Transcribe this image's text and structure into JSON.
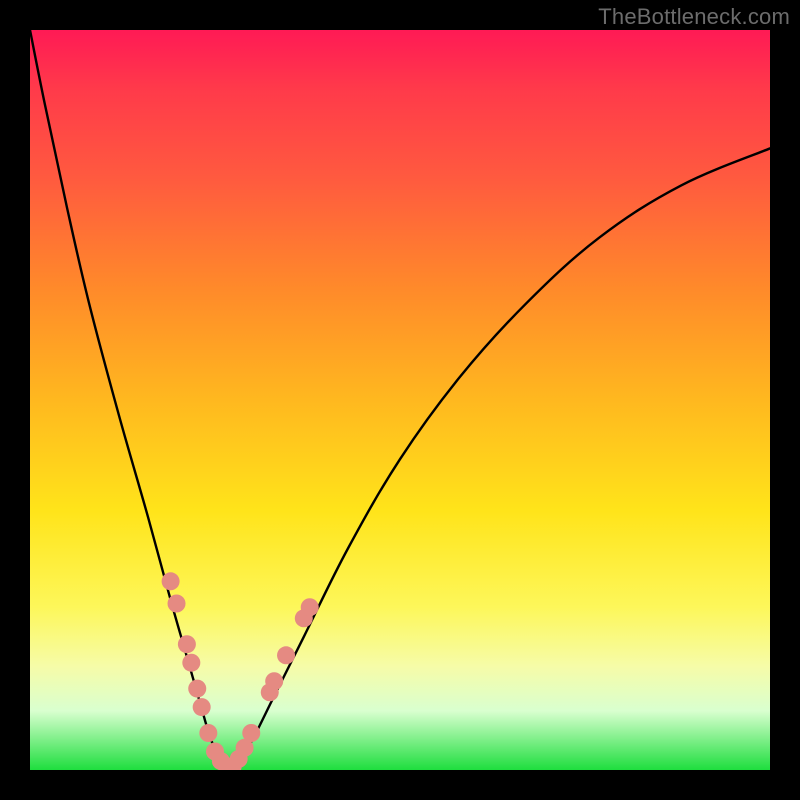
{
  "watermark": {
    "text": "TheBottleneck.com"
  },
  "chart_data": {
    "type": "line",
    "title": "",
    "xlabel": "",
    "ylabel": "",
    "xlim": [
      0,
      100
    ],
    "ylim": [
      0,
      100
    ],
    "series": [
      {
        "name": "bottleneck-curve",
        "x": [
          0,
          2,
          5,
          8,
          12,
          16,
          19,
          21,
          23,
          24.5,
          26,
          27,
          28,
          30,
          33,
          37,
          43,
          50,
          58,
          67,
          77,
          88,
          100
        ],
        "y": [
          100,
          90,
          76,
          63,
          48,
          34,
          23,
          16,
          9,
          4,
          1,
          0.2,
          1,
          4,
          10,
          18,
          30,
          42,
          53,
          63,
          72,
          79,
          84
        ]
      }
    ],
    "markers": {
      "name": "highlight-dots",
      "color": "#e58a82",
      "radius_px": 9,
      "points": [
        {
          "x": 19.0,
          "y": 25.5
        },
        {
          "x": 19.8,
          "y": 22.5
        },
        {
          "x": 21.2,
          "y": 17.0
        },
        {
          "x": 21.8,
          "y": 14.5
        },
        {
          "x": 22.6,
          "y": 11.0
        },
        {
          "x": 23.2,
          "y": 8.5
        },
        {
          "x": 24.1,
          "y": 5.0
        },
        {
          "x": 25.0,
          "y": 2.5
        },
        {
          "x": 25.8,
          "y": 1.2
        },
        {
          "x": 26.6,
          "y": 0.5
        },
        {
          "x": 27.4,
          "y": 0.5
        },
        {
          "x": 28.2,
          "y": 1.5
        },
        {
          "x": 29.0,
          "y": 3.0
        },
        {
          "x": 29.9,
          "y": 5.0
        },
        {
          "x": 32.4,
          "y": 10.5
        },
        {
          "x": 33.0,
          "y": 12.0
        },
        {
          "x": 34.6,
          "y": 15.5
        },
        {
          "x": 37.0,
          "y": 20.5
        },
        {
          "x": 37.8,
          "y": 22.0
        }
      ]
    },
    "gradient_stops": [
      {
        "pos": 0.0,
        "color": "#ff1a55"
      },
      {
        "pos": 0.35,
        "color": "#ff8a2a"
      },
      {
        "pos": 0.65,
        "color": "#ffe41a"
      },
      {
        "pos": 0.92,
        "color": "#d9ffcf"
      },
      {
        "pos": 1.0,
        "color": "#1ede3e"
      }
    ]
  }
}
